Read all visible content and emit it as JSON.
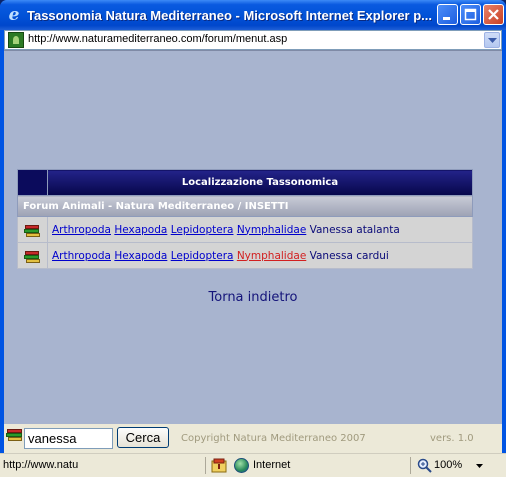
{
  "window": {
    "title": "Tassonomia Natura Mediterraneo - Microsoft Internet Explorer p..."
  },
  "address_bar": {
    "url": "http://www.naturamediterraneo.com/forum/menut.asp"
  },
  "taxonomy": {
    "header": "Localizzazione Tassonomica",
    "subheader": "Forum Animali - Natura Mediterraneo / INSETTI",
    "rows": [
      {
        "links": [
          "Arthropoda",
          "Hexapoda",
          "Lepidoptera",
          "Nymphalidae"
        ],
        "species": "Vanessa atalanta"
      },
      {
        "links": [
          "Arthropoda",
          "Hexapoda",
          "Lepidoptera",
          "Nymphalidae"
        ],
        "species": "Vanessa cardui"
      }
    ],
    "back_link": "Torna indietro"
  },
  "search": {
    "value": "vanessa",
    "button_label": "Cerca",
    "copyright": "Copyright Natura Mediterraneo 2007",
    "version": "vers. 1.0"
  },
  "status_bar": {
    "status_text": "http://www.natu",
    "zone": "Internet",
    "zoom": "100%"
  },
  "colors": {
    "content_bg": "#a8b4cf",
    "header_bg": "#06064a",
    "link": "#0000cc",
    "visited_link": "#d22020"
  }
}
